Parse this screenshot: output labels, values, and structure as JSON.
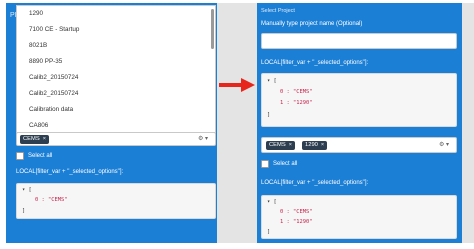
{
  "left": {
    "panel_title_stub": "Pl",
    "dropdown_options": [
      "1290",
      "7100 CE - Startup",
      "8021B",
      "8890 PP-35",
      "Calib2_20150724",
      "Calib2_20150724",
      "Calibration data",
      "CA806"
    ],
    "selected_tags": [
      "CEMS"
    ],
    "select_controls": "⚙ ▾",
    "select_all_label": "Select all",
    "filter_label": "LOCAL[filter_var + \"_selected_options\"]:",
    "code_lines": [
      "▾ [",
      "0 : \"CEMS\"",
      "]"
    ]
  },
  "right": {
    "panel_header": "Select Project",
    "type_label": "Manually type project name (Optional)",
    "input_value": "",
    "filter_label_top": "LOCAL[filter_var + \"_selected_options\"]:",
    "code_top": [
      "▾ [",
      "0 : \"CEMS\"",
      "1 : \"1290\"",
      "]"
    ],
    "selected_tags": [
      "CEMS",
      "1290"
    ],
    "select_controls": "⚙ ▾",
    "select_all_label": "Select all",
    "filter_label_bottom": "LOCAL[filter_var + \"_selected_options\"]:",
    "code_bottom": [
      "▾ [",
      "0 : \"CEMS\"",
      "1 : \"1290\"",
      "]"
    ]
  },
  "colors": {
    "panel_blue": "#1c7fd6",
    "arrow_red": "#e8251b",
    "tag_dark": "#2c3e50",
    "string_red": "#c7254e"
  },
  "icons": {
    "arrow": "right-arrow-icon",
    "gear": "gear-icon",
    "chevron": "chevron-down-icon",
    "remove": "close-icon"
  }
}
